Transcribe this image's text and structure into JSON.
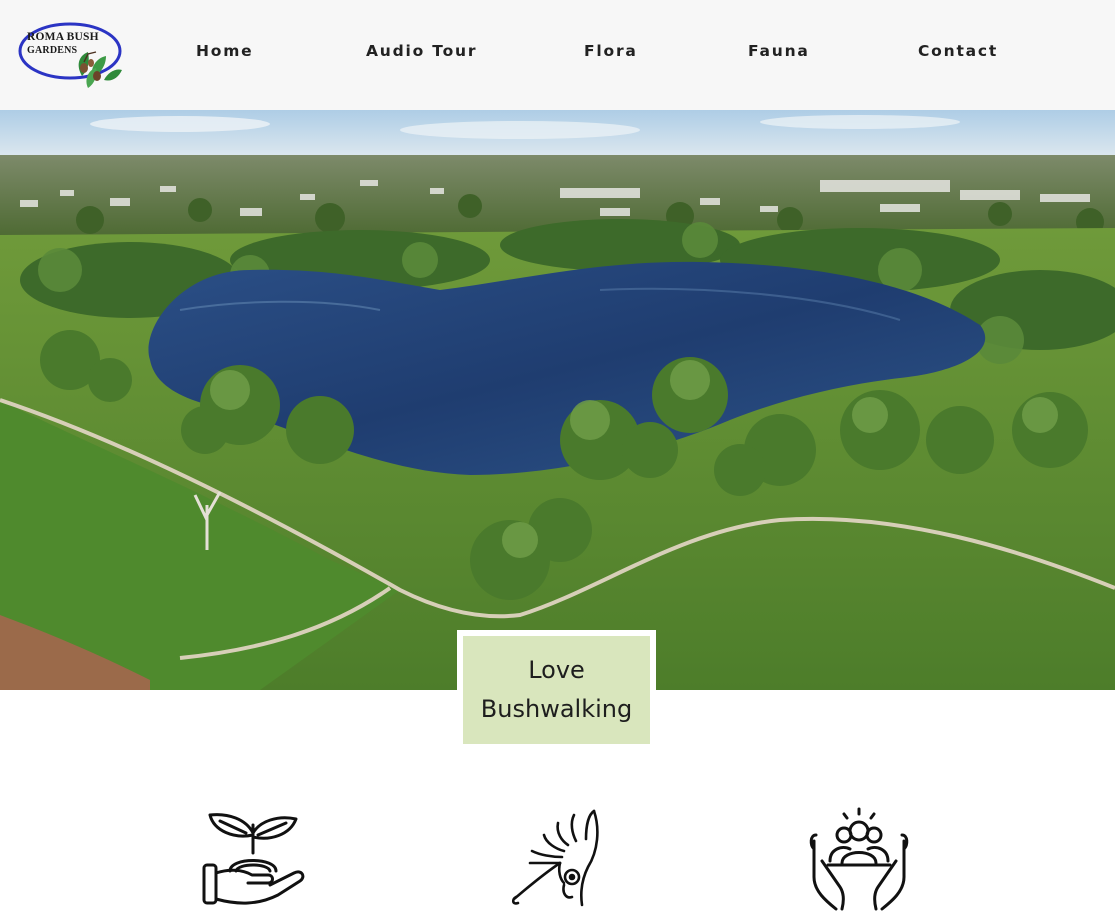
{
  "logo": {
    "line1": "ROMA BUSH",
    "line2": "GARDENS"
  },
  "nav": {
    "items": [
      {
        "label": "Home"
      },
      {
        "label": "Audio Tour"
      },
      {
        "label": "Flora"
      },
      {
        "label": "Fauna"
      },
      {
        "label": "Contact"
      }
    ]
  },
  "hero": {
    "caption": "Love Bushwalking"
  },
  "features": [
    {
      "icon": "plant-in-hand-icon"
    },
    {
      "icon": "cockatoo-icon"
    },
    {
      "icon": "community-in-hands-icon"
    }
  ],
  "colors": {
    "header_bg": "#f7f7f7",
    "caption_bg": "#d9e6bd",
    "logo_oval": "#2b34c4",
    "nav_text": "#222222"
  }
}
